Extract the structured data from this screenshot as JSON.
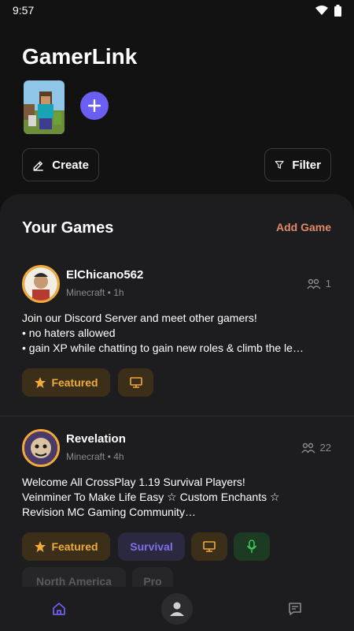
{
  "status_bar": {
    "time": "9:57"
  },
  "header": {
    "title": "GamerLink"
  },
  "actions": {
    "create_label": "Create",
    "filter_label": "Filter"
  },
  "section": {
    "title": "Your Games",
    "add_label": "Add Game"
  },
  "posts": [
    {
      "name": "ElChicano562",
      "meta": "Minecraft • 1h",
      "count": "1",
      "lines": [
        "Join our Discord Server and meet other gamers!",
        "• no haters allowed",
        "• gain XP while chatting to gain new roles & climb the le…"
      ],
      "tags": {
        "featured": "Featured"
      }
    },
    {
      "name": "Revelation",
      "meta": "Minecraft • 4h",
      "count": "22",
      "lines": [
        "Welcome All CrossPlay 1.19 Survival Players!",
        "Veinminer To Make Life Easy ☆ Custom Enchants ☆",
        "Revision MC Gaming Community…"
      ],
      "tags": {
        "featured": "Featured",
        "survival": "Survival",
        "region": "North America",
        "level": "Pro"
      }
    }
  ],
  "colors": {
    "accent_purple": "#6a5ff0",
    "accent_orange": "#f2a93b",
    "link_salmon": "#e0896a",
    "mic_green": "#3ec35b"
  },
  "icons": [
    "wifi-icon",
    "battery-icon",
    "plus-icon",
    "pencil-icon",
    "filter-icon",
    "people-icon",
    "star-icon",
    "monitor-icon",
    "mic-icon",
    "home-icon",
    "person-icon",
    "chat-icon"
  ]
}
